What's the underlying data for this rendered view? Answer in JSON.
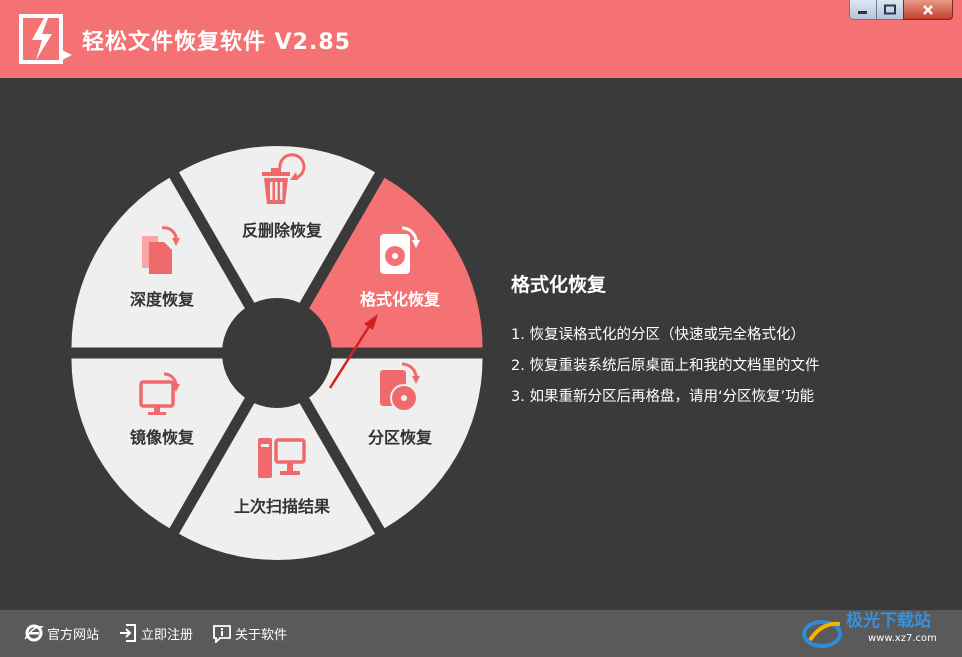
{
  "app": {
    "title": "轻松文件恢复软件 V2.85"
  },
  "window_controls": {
    "minimize": "minimize-icon",
    "maximize": "maximize-icon",
    "close": "close-icon"
  },
  "wheel": {
    "segments": [
      {
        "id": "reverse-delete",
        "label": "反删除恢复",
        "icon": "trash-restore-icon",
        "active": false
      },
      {
        "id": "format",
        "label": "格式化恢复",
        "icon": "disk-restore-icon",
        "active": true
      },
      {
        "id": "partition",
        "label": "分区恢复",
        "icon": "partition-restore-icon",
        "active": false
      },
      {
        "id": "last-scan",
        "label": "上次扫描结果",
        "icon": "computer-icon",
        "active": false
      },
      {
        "id": "mirror",
        "label": "镜像恢复",
        "icon": "monitor-restore-icon",
        "active": false
      },
      {
        "id": "deep",
        "label": "深度恢复",
        "icon": "documents-restore-icon",
        "active": false
      }
    ]
  },
  "info": {
    "title": "格式化恢复",
    "items": [
      "1. 恢复误格式化的分区（快速或完全格式化）",
      "2. 恢复重装系统后原桌面上和我的文档里的文件",
      "3. 如果重新分区后再格盘，请用‘分区恢复’功能"
    ]
  },
  "footer": {
    "links": [
      {
        "label": "官方网站",
        "icon": "ie-icon"
      },
      {
        "label": "立即注册",
        "icon": "register-icon"
      },
      {
        "label": "关于软件",
        "icon": "info-icon"
      }
    ]
  },
  "watermark": {
    "text": "极光下载站",
    "url": "www.xz7.com"
  },
  "colors": {
    "accent": "#f47273",
    "background": "#3a3a3a",
    "segment": "#efefef",
    "footer": "#5a5a5a",
    "arrow": "#d42020"
  }
}
